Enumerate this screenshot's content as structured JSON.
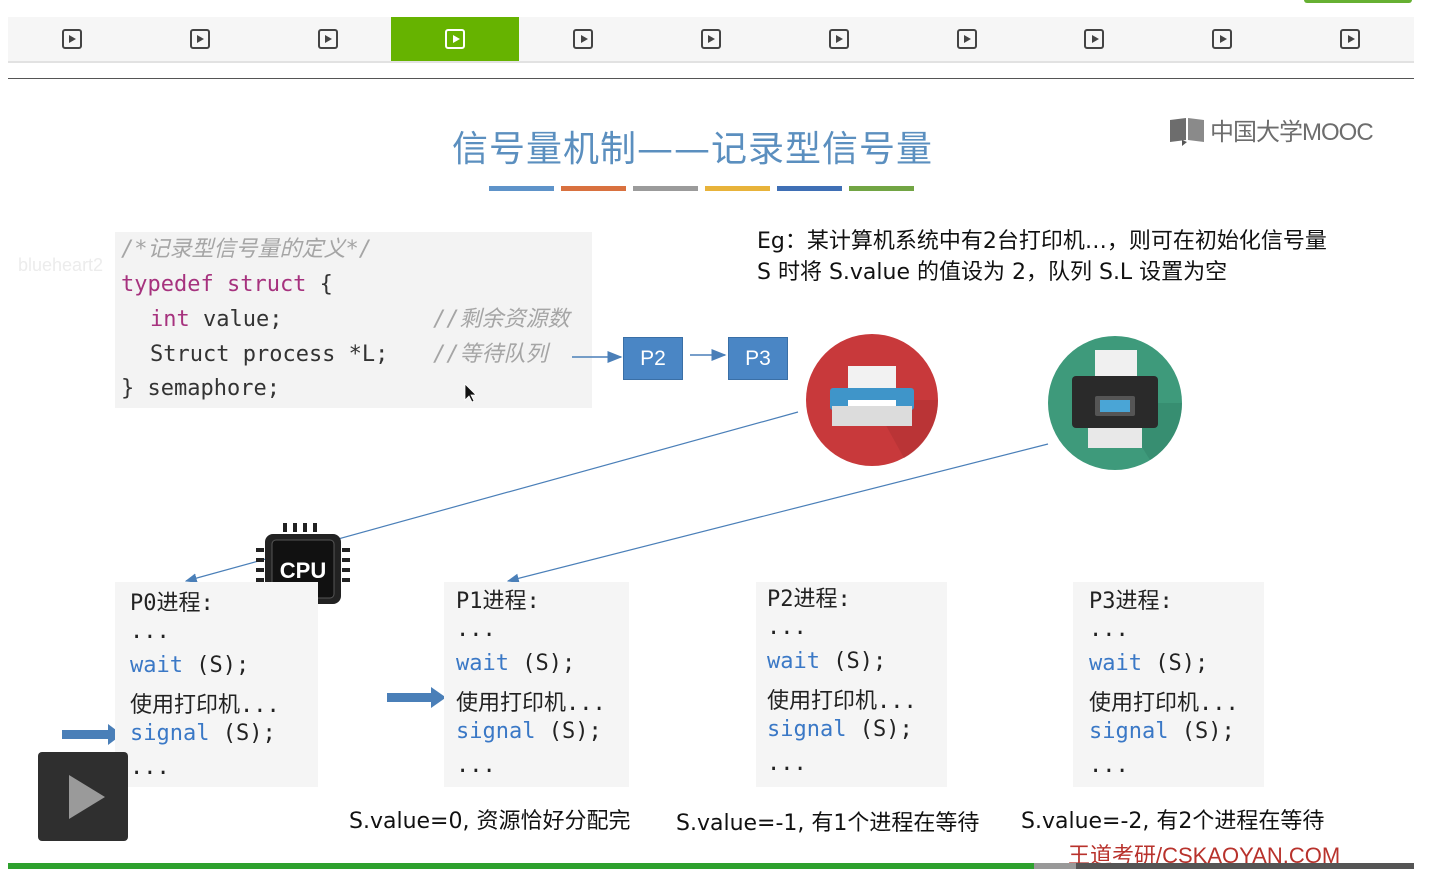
{
  "player": {
    "segment_count": 11,
    "active_segment": 4,
    "progress_fraction": 0.73,
    "buffer_fraction": 0.76,
    "icons": {
      "segment": "play-icon",
      "main": "play-icon"
    }
  },
  "slide": {
    "title": "信号量机制——记录型信号量",
    "stripe_colors": [
      "#5e93c9",
      "#d9713f",
      "#9b9b9b",
      "#e8b33a",
      "#3f6fb5",
      "#72a544"
    ],
    "logo_text": "中国大学MOOC",
    "watermark": "blueheart2",
    "code": {
      "comment_title": "/*记录型信号量的定义*/",
      "l1_kw": "typedef struct",
      "l1_rest": " {",
      "l2_kw": "int",
      "l2_rest": " value;",
      "l2_comment": "//剩余资源数",
      "l3_rest": "Struct process *L;",
      "l3_comment": "//等待队列",
      "l4": "} semaphore;"
    },
    "queue": [
      "P2",
      "P3"
    ],
    "eg_text": "Eg：某计算机系统中有2台打印机…，则可在初始化信号量 S 时将 S.value 的值设为 2，队列 S.L 设置为空",
    "cpu_label": "CPU",
    "processes": [
      {
        "name": "P0进程:",
        "dots1": "...",
        "wait": "wait",
        "wait_arg": " (S);",
        "use": "使用打印机...",
        "signal": "signal",
        "signal_arg": " (S);",
        "dots2": "..."
      },
      {
        "name": "P1进程:",
        "dots1": "...",
        "wait": "wait",
        "wait_arg": " (S);",
        "use": "使用打印机...",
        "signal": "signal",
        "signal_arg": " (S);",
        "dots2": "..."
      },
      {
        "name": "P2进程:",
        "dots1": "...",
        "wait": "wait",
        "wait_arg": " (S);",
        "use": "使用打印机...",
        "signal": "signal",
        "signal_arg": " (S);",
        "dots2": "..."
      },
      {
        "name": "P3进程:",
        "dots1": "...",
        "wait": "wait",
        "wait_arg": " (S);",
        "use": "使用打印机...",
        "signal": "signal",
        "signal_arg": " (S);",
        "dots2": "..."
      }
    ],
    "status": [
      "S.value=0, 资源恰好分配完",
      "S.value=-1, 有1个进程在等待",
      "S.value=-2, 有2个进程在等待"
    ],
    "brand": "王道考研/CSKAOYAN.COM",
    "colors": {
      "printer1_bg": "#c8393b",
      "printer2_bg": "#3e9a7b",
      "queue_box": "#4a86c5",
      "arrow": "#4a7fb8"
    }
  }
}
